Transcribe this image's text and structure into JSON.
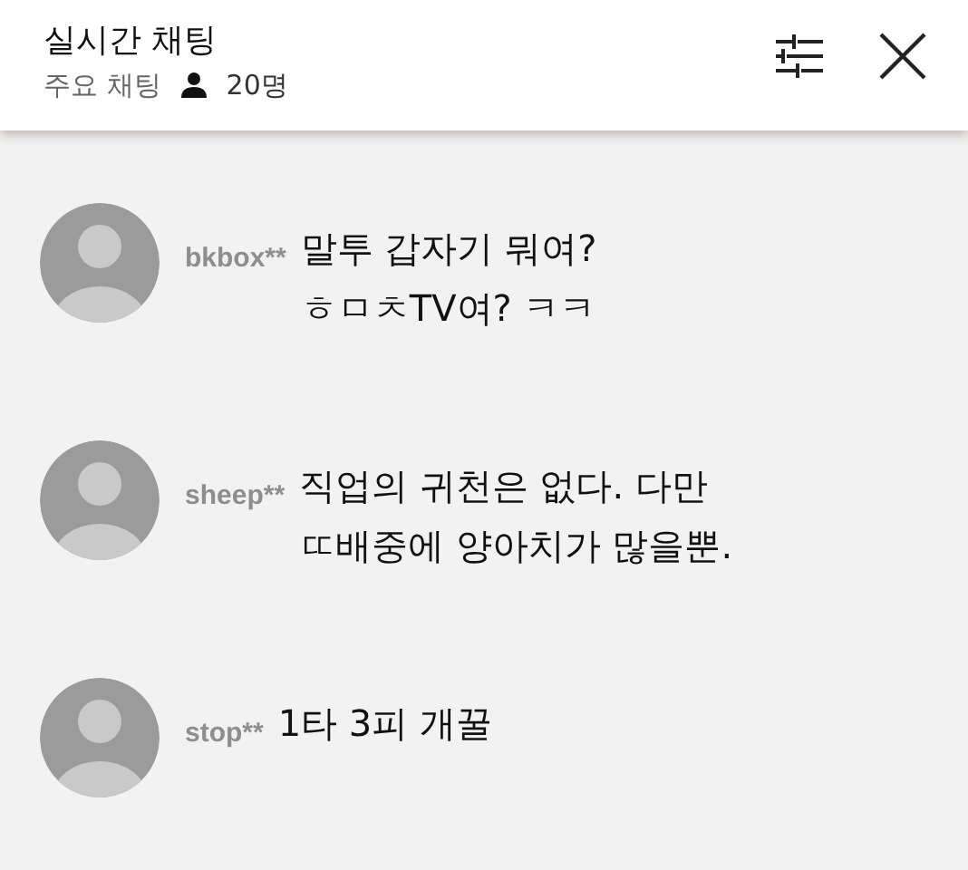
{
  "header": {
    "title": "실시간 채팅",
    "subtitle": "주요 채팅",
    "count": "20명"
  },
  "messages": [
    {
      "user": "bkbox**",
      "lines": [
        "말투 갑자기 뭐여?",
        "ㅎㅁㅊTV여? ㅋㅋ"
      ]
    },
    {
      "user": "sheep**",
      "lines": [
        "직업의 귀천은 없다. 다만",
        "ㄸ배중에 양아치가 많을뿐."
      ]
    },
    {
      "user": "stop**",
      "lines": [
        "1타 3피 개꿀"
      ]
    }
  ]
}
